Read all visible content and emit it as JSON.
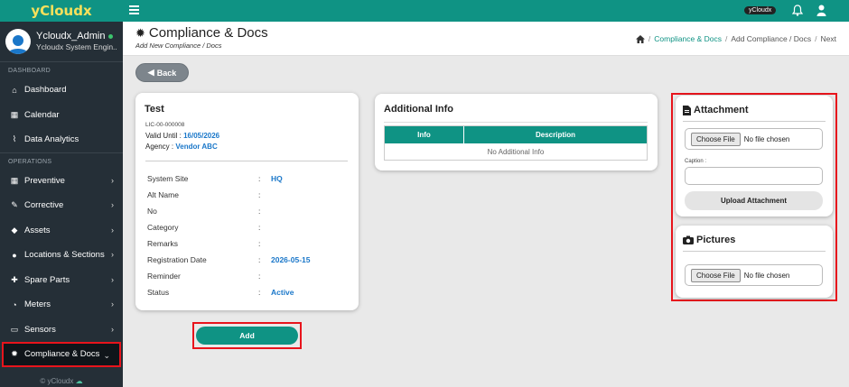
{
  "brand": {
    "name": "yCloudx"
  },
  "user": {
    "name": "Ycloudx_Admin",
    "role": "Ycloudx System Engin..."
  },
  "sidebar": {
    "sections": {
      "dashboard": "DASHBOARD",
      "operations": "OPERATIONS"
    },
    "items": [
      {
        "label": "Dashboard",
        "icon": "home-icon",
        "chevron": false
      },
      {
        "label": "Calendar",
        "icon": "calendar-icon",
        "chevron": false
      },
      {
        "label": "Data Analytics",
        "icon": "chart-icon",
        "chevron": false
      },
      {
        "label": "Preventive",
        "icon": "calendar-check-icon",
        "chevron": true
      },
      {
        "label": "Corrective",
        "icon": "wrench-icon",
        "chevron": true
      },
      {
        "label": "Assets",
        "icon": "tag-icon",
        "chevron": true
      },
      {
        "label": "Locations & Sections",
        "icon": "globe-icon",
        "chevron": true
      },
      {
        "label": "Spare Parts",
        "icon": "puzzle-icon",
        "chevron": true
      },
      {
        "label": "Meters",
        "icon": "gauge-icon",
        "chevron": true
      },
      {
        "label": "Sensors",
        "icon": "monitor-icon",
        "chevron": true
      },
      {
        "label": "Compliance & Docs",
        "icon": "certificate-icon",
        "chevron": true,
        "active": true
      }
    ],
    "footer": "© yCloudx"
  },
  "topbar": {
    "badge": "yCloudx"
  },
  "header": {
    "title": "Compliance & Docs",
    "subtitle": "Add New Compliance / Docs",
    "breadcrumb": [
      "Compliance & Docs",
      "Add Compliance / Docs",
      "Next"
    ]
  },
  "back_label": "Back",
  "doc": {
    "title": "Test",
    "number": "LIC-00-000008",
    "valid_label": "Valid Until : ",
    "valid_value": "16/05/2026",
    "agency_label": "Agency : ",
    "agency_value": "Vendor ABC",
    "fields": [
      {
        "label": "System Site",
        "value": "HQ"
      },
      {
        "label": "Alt Name",
        "value": ""
      },
      {
        "label": "No",
        "value": ""
      },
      {
        "label": "Category",
        "value": ""
      },
      {
        "label": "Remarks",
        "value": ""
      },
      {
        "label": "Registration Date",
        "value": "2026-05-15"
      },
      {
        "label": "Reminder",
        "value": ""
      },
      {
        "label": "Status",
        "value": "Active"
      }
    ]
  },
  "add_label": "Add",
  "additional_info": {
    "title": "Additional Info",
    "columns": [
      "Info",
      "Description"
    ],
    "empty_text": "No Additional Info"
  },
  "attachment": {
    "title": "Attachment",
    "choose_label": "Choose File",
    "no_file": "No file chosen",
    "caption_label": "Caption :",
    "upload_label": "Upload Attachment"
  },
  "pictures": {
    "title": "Pictures",
    "choose_label": "Choose File",
    "no_file": "No file chosen"
  },
  "colors": {
    "accent": "#0f9384",
    "sidebar": "#252f37",
    "highlight": "#e8141c",
    "link": "#1a77c9"
  }
}
